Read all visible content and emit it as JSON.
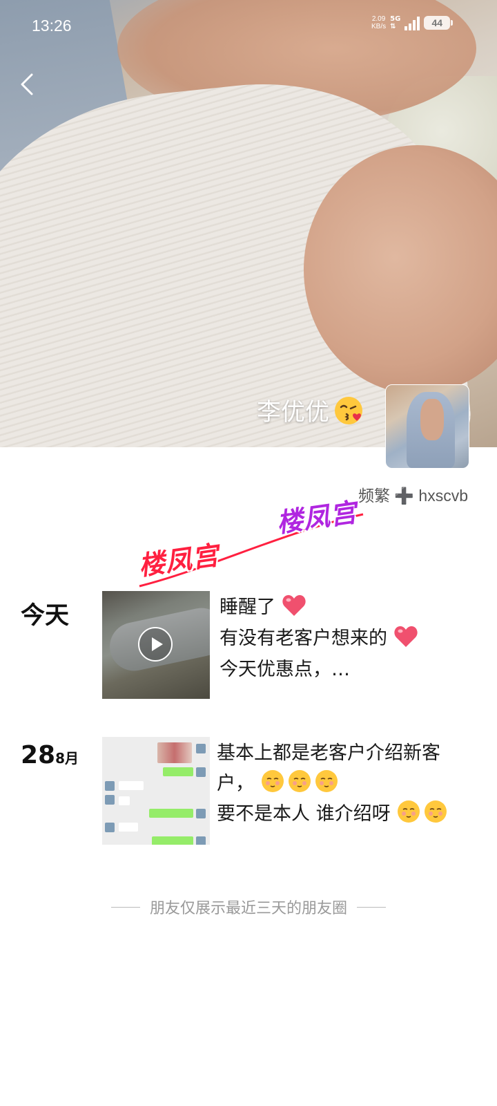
{
  "status_bar": {
    "time": "13:26",
    "net_speed": "2.09",
    "net_unit": "KB/s",
    "network": "5G",
    "battery": "44"
  },
  "profile": {
    "nickname": "李优优",
    "nickname_emoji": "kissing-face-emoji",
    "signature": "频繁 ➕ hxscvb"
  },
  "watermark": {
    "text_left": "楼凤宫",
    "text_right": "楼凤宫"
  },
  "posts": [
    {
      "date": "今天",
      "media": "video",
      "lines": [
        "睡醒了",
        "有没有老客户想来的",
        "今天优惠点，…"
      ]
    },
    {
      "date_day": "28",
      "date_month": "8月",
      "media": "image",
      "lines": [
        "基本上都是老客户介绍新客户，",
        "要不是本人  谁介绍呀"
      ]
    }
  ],
  "footer": {
    "note": "朋友仅展示最近三天的朋友圈"
  },
  "colors": {
    "heart": "#f0506e",
    "watermark_red": "#ff2040",
    "watermark_purple": "#b026e0"
  }
}
